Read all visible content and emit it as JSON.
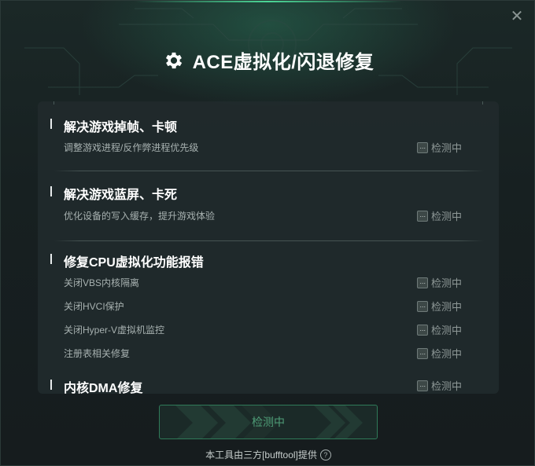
{
  "window": {
    "title": "ACE虚拟化/闪退修复",
    "close_glyph": "✕",
    "accent_color": "#2f7a59",
    "icon": "gear-icon"
  },
  "sections": [
    {
      "title": "解决游戏掉帧、卡顿",
      "items": [
        {
          "label": "调整游戏进程/反作弊进程优先级",
          "status": "检测中"
        }
      ]
    },
    {
      "title": "解决游戏蓝屏、卡死",
      "items": [
        {
          "label": "优化设备的写入缓存，提升游戏体验",
          "status": "检测中"
        }
      ]
    },
    {
      "title": "修复CPU虚拟化功能报错",
      "items": [
        {
          "label": "关闭VBS内核隔离",
          "status": "检测中"
        },
        {
          "label": "关闭HVCI保护",
          "status": "检测中"
        },
        {
          "label": "关闭Hyper-V虚拟机监控",
          "status": "检测中"
        },
        {
          "label": "注册表相关修复",
          "status": "检测中"
        }
      ]
    },
    {
      "title": "内核DMA修复",
      "status": "检测中"
    }
  ],
  "status_icon_glyph": "···",
  "main_button": {
    "label": "检测中"
  },
  "footer": {
    "text": "本工具由三方[bufftool]提供",
    "help_glyph": "?"
  }
}
